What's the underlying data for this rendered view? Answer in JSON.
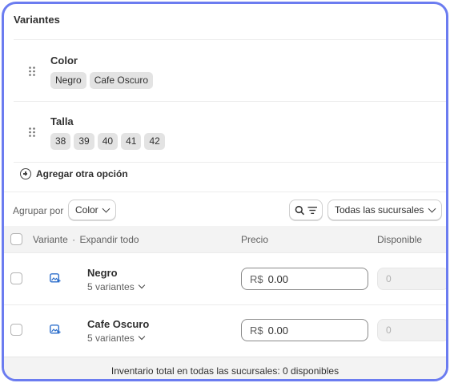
{
  "card": {
    "title": "Variantes"
  },
  "options": [
    {
      "name": "Color",
      "values": [
        "Negro",
        "Cafe Oscuro"
      ]
    },
    {
      "name": "Talla",
      "values": [
        "38",
        "39",
        "40",
        "41",
        "42"
      ]
    }
  ],
  "add_option_label": "Agregar otra opción",
  "toolbar": {
    "group_by_label": "Agrupar por",
    "group_by_value": "Color",
    "location_filter": "Todas las sucursales"
  },
  "table": {
    "headers": {
      "variant": "Variante",
      "separator": "·",
      "expand_all": "Expandir todo",
      "price": "Precio",
      "available": "Disponible"
    },
    "rows": [
      {
        "name": "Negro",
        "variant_count": "5 variantes",
        "currency": "R$",
        "price": "0.00",
        "available": "0"
      },
      {
        "name": "Cafe Oscuro",
        "variant_count": "5 variantes",
        "currency": "R$",
        "price": "0.00",
        "available": "0"
      }
    ]
  },
  "footer": {
    "text": "Inventario total en todas las sucursales: 0 disponibles"
  },
  "colors": {
    "frame": "#6b7cf0",
    "icon_blue": "#2c6ecb",
    "chip_bg": "#e3e3e3"
  }
}
